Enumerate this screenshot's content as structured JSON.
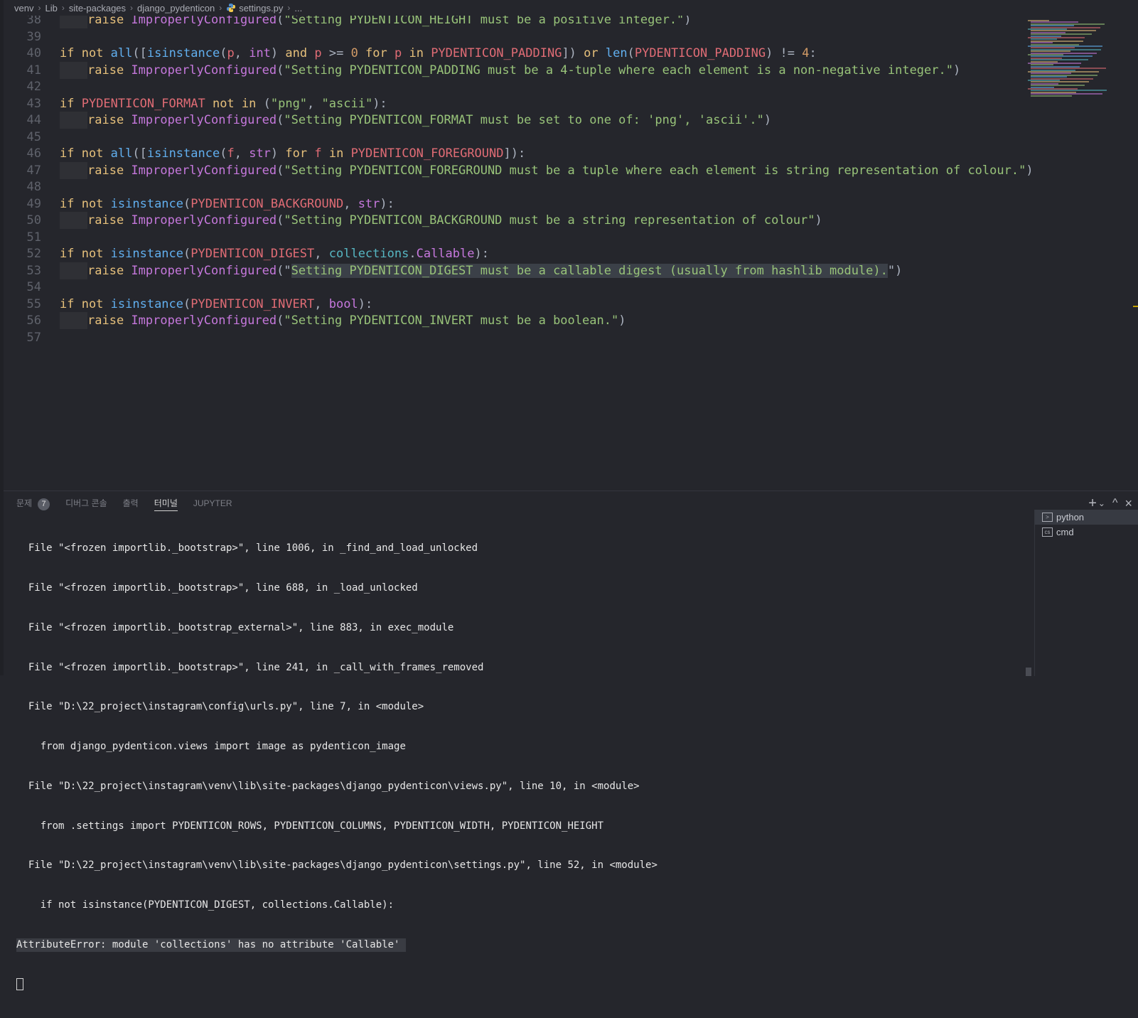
{
  "breadcrumb": [
    "venv",
    "Lib",
    "site-packages",
    "django_pydenticon",
    "settings.py",
    "..."
  ],
  "code": {
    "lines": [
      {
        "num": "38",
        "indent": true,
        "tokens": [
          [
            "kw",
            "raise "
          ],
          [
            "cls",
            "ImproperlyConfigured"
          ],
          [
            "op",
            "("
          ],
          [
            "str",
            "\"Setting PYDENTICON_HEIGHT must be a positive integer.\""
          ],
          [
            "op",
            ")"
          ]
        ]
      },
      {
        "num": "39",
        "indent": false,
        "tokens": []
      },
      {
        "num": "40",
        "indent": false,
        "tokens": [
          [
            "kw",
            "if not "
          ],
          [
            "fn",
            "all"
          ],
          [
            "op",
            "(["
          ],
          [
            "fn",
            "isinstance"
          ],
          [
            "op",
            "("
          ],
          [
            "const",
            "p"
          ],
          [
            "op",
            ", "
          ],
          [
            "cls",
            "int"
          ],
          [
            "op",
            ") "
          ],
          [
            "kw",
            "and "
          ],
          [
            "const",
            "p "
          ],
          [
            "op",
            ">= "
          ],
          [
            "num",
            "0 "
          ],
          [
            "kw",
            "for "
          ],
          [
            "const",
            "p "
          ],
          [
            "kw",
            "in "
          ],
          [
            "const",
            "PYDENTICON_PADDING"
          ],
          [
            "op",
            "]) "
          ],
          [
            "kw",
            "or "
          ],
          [
            "fn",
            "len"
          ],
          [
            "op",
            "("
          ],
          [
            "const",
            "PYDENTICON_PADDING"
          ],
          [
            "op",
            ") != "
          ],
          [
            "num",
            "4"
          ],
          [
            "op",
            ":"
          ]
        ]
      },
      {
        "num": "41",
        "indent": true,
        "tokens": [
          [
            "kw",
            "raise "
          ],
          [
            "cls",
            "ImproperlyConfigured"
          ],
          [
            "op",
            "("
          ],
          [
            "str",
            "\"Setting PYDENTICON_PADDING must be a 4-tuple where each element is a non-negative integer.\""
          ],
          [
            "op",
            ")"
          ]
        ]
      },
      {
        "num": "42",
        "indent": false,
        "tokens": []
      },
      {
        "num": "43",
        "indent": false,
        "tokens": [
          [
            "kw",
            "if "
          ],
          [
            "const",
            "PYDENTICON_FORMAT "
          ],
          [
            "kw",
            "not in "
          ],
          [
            "op",
            "("
          ],
          [
            "str",
            "\"png\""
          ],
          [
            "op",
            ", "
          ],
          [
            "str",
            "\"ascii\""
          ],
          [
            "op",
            "):"
          ]
        ]
      },
      {
        "num": "44",
        "indent": true,
        "tokens": [
          [
            "kw",
            "raise "
          ],
          [
            "cls",
            "ImproperlyConfigured"
          ],
          [
            "op",
            "("
          ],
          [
            "str",
            "\"Setting PYDENTICON_FORMAT must be set to one of: 'png', 'ascii'.\""
          ],
          [
            "op",
            ")"
          ]
        ]
      },
      {
        "num": "45",
        "indent": false,
        "tokens": []
      },
      {
        "num": "46",
        "indent": false,
        "tokens": [
          [
            "kw",
            "if not "
          ],
          [
            "fn",
            "all"
          ],
          [
            "op",
            "(["
          ],
          [
            "fn",
            "isinstance"
          ],
          [
            "op",
            "("
          ],
          [
            "const",
            "f"
          ],
          [
            "op",
            ", "
          ],
          [
            "cls",
            "str"
          ],
          [
            "op",
            ") "
          ],
          [
            "kw",
            "for "
          ],
          [
            "const",
            "f "
          ],
          [
            "kw",
            "in "
          ],
          [
            "const",
            "PYDENTICON_FOREGROUND"
          ],
          [
            "op",
            "]):"
          ]
        ]
      },
      {
        "num": "47",
        "indent": true,
        "tokens": [
          [
            "kw",
            "raise "
          ],
          [
            "cls",
            "ImproperlyConfigured"
          ],
          [
            "op",
            "("
          ],
          [
            "str",
            "\"Setting PYDENTICON_FOREGROUND must be a tuple where each element is string representation of colour.\""
          ],
          [
            "op",
            ")"
          ]
        ]
      },
      {
        "num": "48",
        "indent": false,
        "tokens": []
      },
      {
        "num": "49",
        "indent": false,
        "tokens": [
          [
            "kw",
            "if not "
          ],
          [
            "fn",
            "isinstance"
          ],
          [
            "op",
            "("
          ],
          [
            "const",
            "PYDENTICON_BACKGROUND"
          ],
          [
            "op",
            ", "
          ],
          [
            "cls",
            "str"
          ],
          [
            "op",
            "):"
          ]
        ]
      },
      {
        "num": "50",
        "indent": true,
        "tokens": [
          [
            "kw",
            "raise "
          ],
          [
            "cls",
            "ImproperlyConfigured"
          ],
          [
            "op",
            "("
          ],
          [
            "str",
            "\"Setting PYDENTICON_BACKGROUND must be a string representation of colour\""
          ],
          [
            "op",
            ")"
          ]
        ]
      },
      {
        "num": "51",
        "indent": false,
        "tokens": []
      },
      {
        "num": "52",
        "indent": false,
        "tokens": [
          [
            "kw",
            "if not "
          ],
          [
            "fn",
            "isinstance"
          ],
          [
            "op",
            "("
          ],
          [
            "const",
            "PYDENTICON_DIGEST"
          ],
          [
            "op",
            ", "
          ],
          [
            "bi",
            "collections"
          ],
          [
            "op",
            "."
          ],
          [
            "cls",
            "Callable"
          ],
          [
            "op",
            "):"
          ]
        ]
      },
      {
        "num": "53",
        "indent": true,
        "tokens": [
          [
            "kw",
            "raise "
          ],
          [
            "cls",
            "ImproperlyConfigured"
          ],
          [
            "op",
            "(\""
          ],
          [
            "strhl",
            "Setting PYDENTICON_DIGEST must be a callable digest (usually from hashlib module)."
          ],
          [
            "op",
            "\")"
          ]
        ]
      },
      {
        "num": "54",
        "indent": false,
        "tokens": []
      },
      {
        "num": "55",
        "indent": false,
        "tokens": [
          [
            "kw",
            "if not "
          ],
          [
            "fn",
            "isinstance"
          ],
          [
            "op",
            "("
          ],
          [
            "const",
            "PYDENTICON_INVERT"
          ],
          [
            "op",
            ", "
          ],
          [
            "cls",
            "bool"
          ],
          [
            "op",
            "):"
          ]
        ]
      },
      {
        "num": "56",
        "indent": true,
        "tokens": [
          [
            "kw",
            "raise "
          ],
          [
            "cls",
            "ImproperlyConfigured"
          ],
          [
            "op",
            "("
          ],
          [
            "str",
            "\"Setting PYDENTICON_INVERT must be a boolean.\""
          ],
          [
            "op",
            ")"
          ]
        ]
      },
      {
        "num": "57",
        "indent": false,
        "tokens": []
      }
    ]
  },
  "panel": {
    "tabs": [
      {
        "label": "문제",
        "badge": "7"
      },
      {
        "label": "디버그 콘솔"
      },
      {
        "label": "출력"
      },
      {
        "label": "터미널"
      },
      {
        "label": "JUPYTER"
      }
    ],
    "actions": {
      "add": "+",
      "chevron": "⌄",
      "maximize": "^",
      "close": "×"
    },
    "terminal_lines": [
      "  File \"<frozen importlib._bootstrap>\", line 1006, in _find_and_load_unlocked",
      "  File \"<frozen importlib._bootstrap>\", line 688, in _load_unlocked",
      "  File \"<frozen importlib._bootstrap_external>\", line 883, in exec_module",
      "  File \"<frozen importlib._bootstrap>\", line 241, in _call_with_frames_removed",
      "  File \"D:\\22_project\\instagram\\config\\urls.py\", line 7, in <module>",
      "    from django_pydenticon.views import image as pydenticon_image",
      "  File \"D:\\22_project\\instagram\\venv\\lib\\site-packages\\django_pydenticon\\views.py\", line 10, in <module>",
      "    from .settings import PYDENTICON_ROWS, PYDENTICON_COLUMNS, PYDENTICON_WIDTH, PYDENTICON_HEIGHT",
      "  File \"D:\\22_project\\instagram\\venv\\lib\\site-packages\\django_pydenticon\\settings.py\", line 52, in <module>",
      "    if not isinstance(PYDENTICON_DIGEST, collections.Callable):"
    ],
    "error_line": "AttributeError: module 'collections' has no attribute 'Callable' ",
    "terminals": [
      "python",
      "cmd"
    ]
  }
}
